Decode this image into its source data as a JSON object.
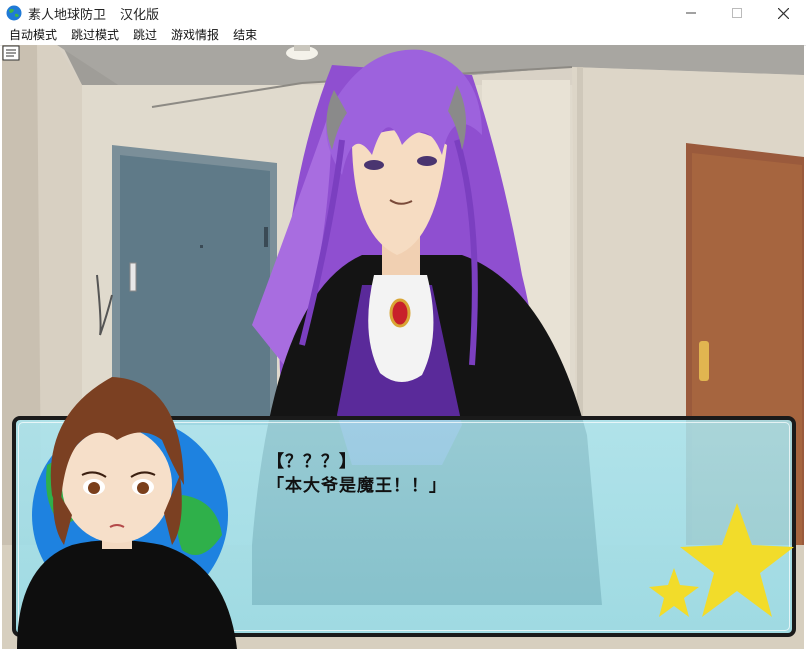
{
  "window": {
    "title": "素人地球防卫",
    "subtitle": "汉化版"
  },
  "menu": {
    "items": [
      {
        "label": "自动模式"
      },
      {
        "label": "跳过模式"
      },
      {
        "label": "跳过"
      },
      {
        "label": "游戏情报"
      },
      {
        "label": "结束"
      }
    ]
  },
  "dialogue": {
    "speaker": "【？？？】",
    "text": "「本大爷是魔王！！」"
  },
  "colors": {
    "dialog_bg": "#a9e3ec",
    "hair_purple": "#9b5fd6",
    "suit": "#151515",
    "star": "#f2dc2a"
  }
}
